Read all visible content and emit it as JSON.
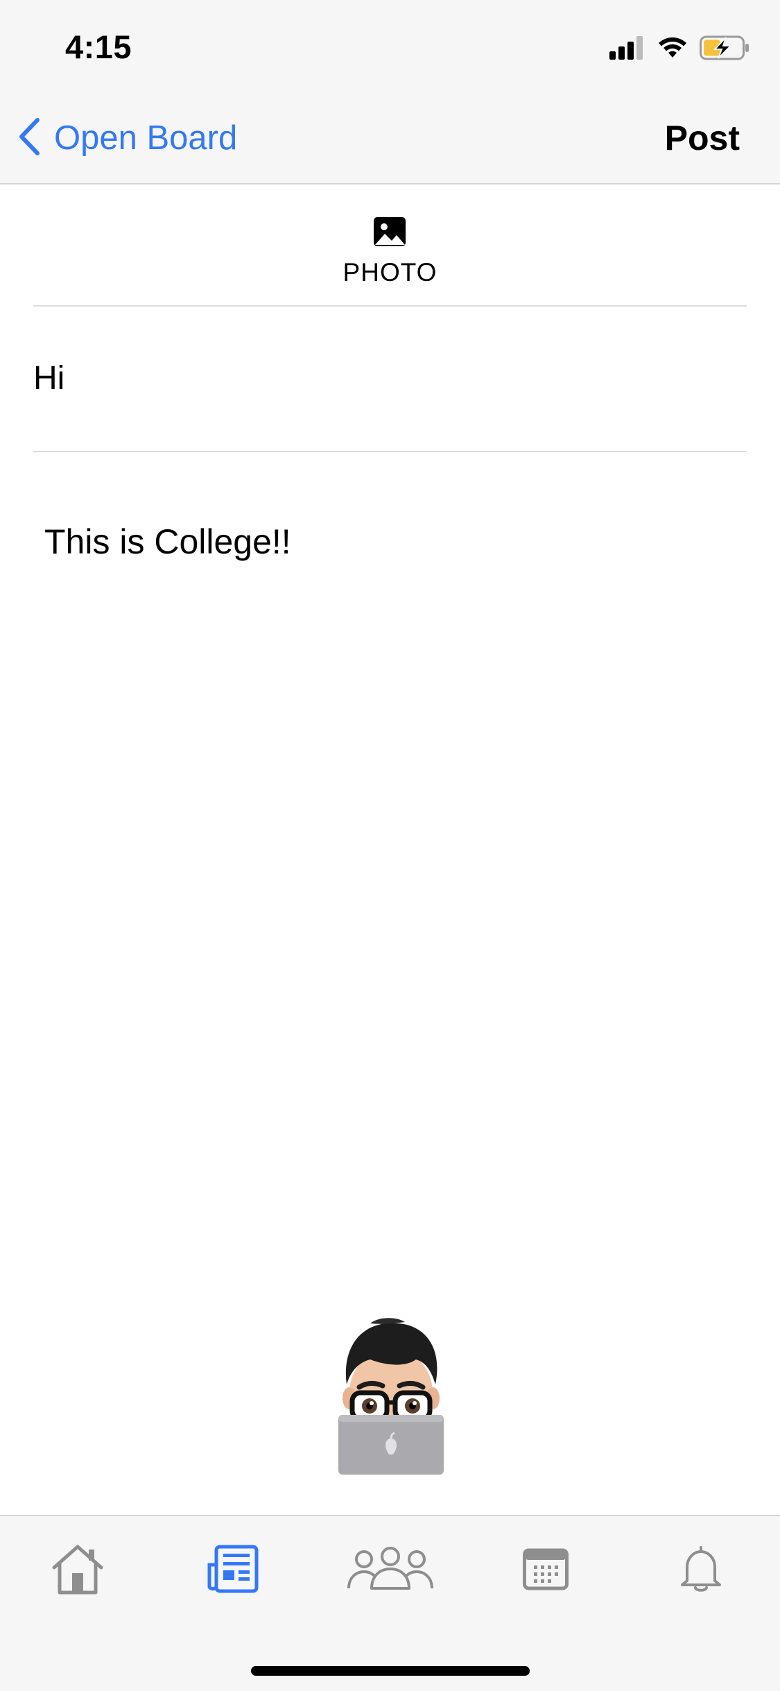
{
  "status_bar": {
    "time": "4:15",
    "icons": [
      "cellular-signal-icon",
      "wifi-icon",
      "battery-charging-icon"
    ],
    "battery_color": "#f5c33b"
  },
  "nav_bar": {
    "back_label": "Open Board",
    "action_label": "Post",
    "accent_color": "#3478f6"
  },
  "composer": {
    "photo_label": "PHOTO",
    "title_value": "Hi",
    "body_value": "This is College!!"
  },
  "tab_bar": {
    "selected_index": 1,
    "selected_color": "#3478f6",
    "inactive_color": "#8e8e8e",
    "tabs": [
      {
        "icon": "home-icon"
      },
      {
        "icon": "board-icon"
      },
      {
        "icon": "people-icon"
      },
      {
        "icon": "calendar-icon"
      },
      {
        "icon": "bell-icon"
      }
    ]
  }
}
